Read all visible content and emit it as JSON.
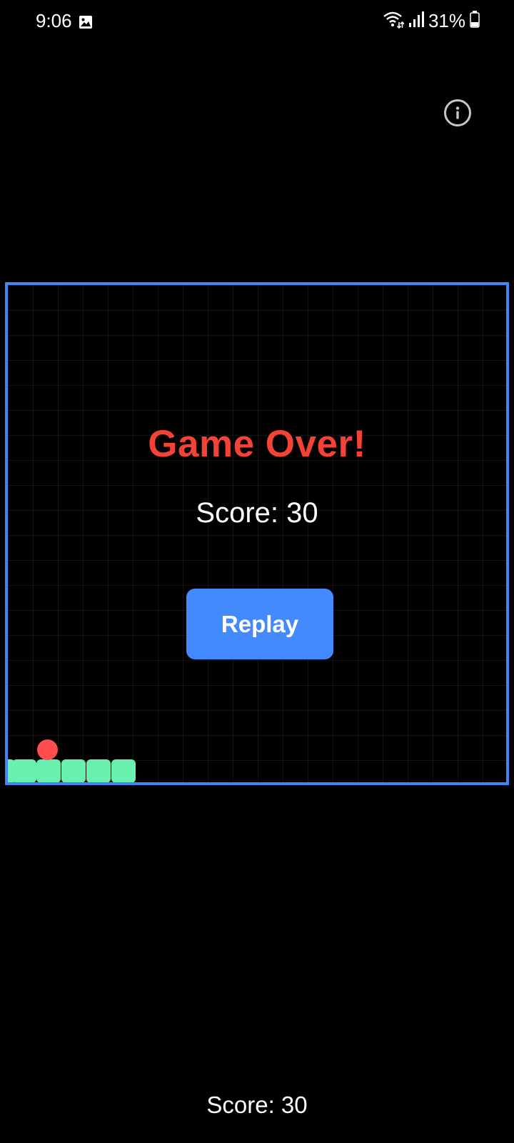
{
  "status_bar": {
    "time": "9:06",
    "battery": "31%",
    "icons": [
      "gallery-icon",
      "wifi-icon",
      "signal-icon",
      "battery-icon"
    ]
  },
  "toolbar": {
    "info_icon": "info-icon"
  },
  "game": {
    "overlay_title": "Game Over!",
    "overlay_score": "Score: 30",
    "replay_label": "Replay",
    "snake_length": 6
  },
  "footer": {
    "score_text": "Score: 30"
  },
  "colors": {
    "background": "#000000",
    "board_border": "#4285f4",
    "title": "#f44336",
    "button": "#448aff",
    "snake": "#69f0ae",
    "food": "#ff4d4d"
  }
}
